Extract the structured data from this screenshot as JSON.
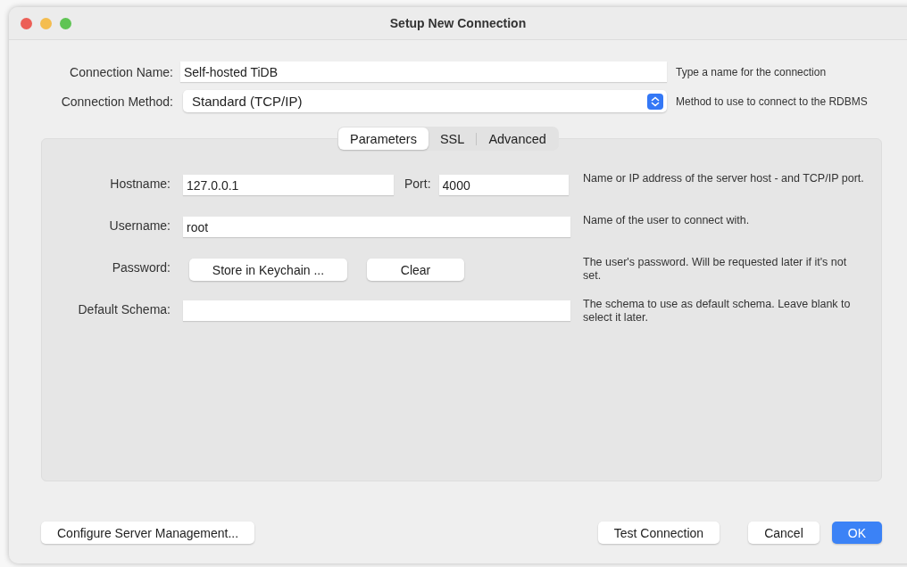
{
  "window": {
    "title": "Setup New Connection"
  },
  "connection": [
    {
      "kind": "text",
      "label": "Connection Name:",
      "value": "Self-hosted TiDB",
      "hint": "Type a name for the connection"
    },
    {
      "kind": "select",
      "label": "Connection Method:",
      "value": "Standard (TCP/IP)",
      "hint": "Method to use to connect to the RDBMS"
    }
  ],
  "tabs": [
    {
      "label": "Parameters",
      "selected": true
    },
    {
      "label": "SSL",
      "selected": false
    },
    {
      "label": "Advanced",
      "selected": false
    }
  ],
  "parameters": [
    {
      "kind": "host_port",
      "label": "Hostname:",
      "value": "127.0.0.1",
      "port_label": "Port:",
      "port_value": "4000",
      "hint": "Name or IP address of the server host - and TCP/IP port."
    },
    {
      "kind": "text",
      "label": "Username:",
      "value": "root",
      "hint": "Name of the user to connect with."
    },
    {
      "kind": "buttons",
      "label": "Password:",
      "buttons": [
        "Store in Keychain ...",
        "Clear"
      ],
      "hint": "The user's password. Will be requested later if it's not set."
    },
    {
      "kind": "text",
      "label": "Default Schema:",
      "hint": "The schema to use as default schema. Leave blank to select it later."
    }
  ],
  "footer": {
    "left": [
      {
        "label": "Configure Server Management...",
        "default": false
      }
    ],
    "right": [
      {
        "label": "Test Connection",
        "default": false
      },
      {
        "label": "Cancel",
        "default": false
      },
      {
        "label": "OK",
        "default": true
      }
    ]
  }
}
